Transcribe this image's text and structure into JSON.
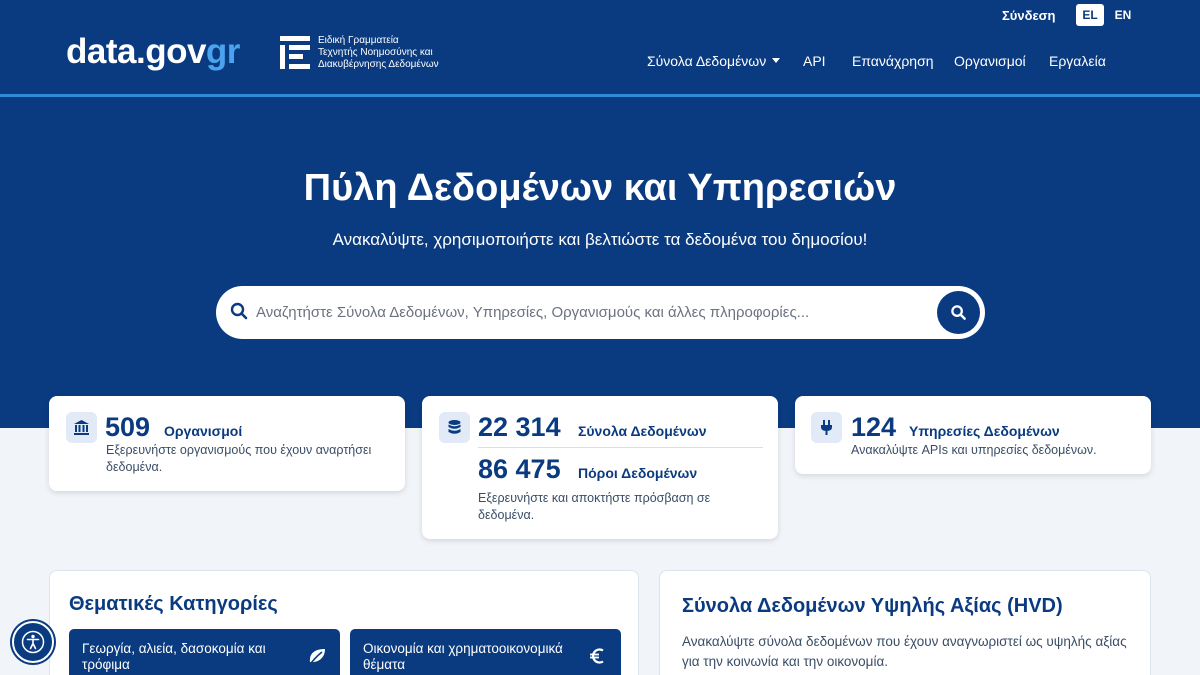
{
  "header": {
    "logo": {
      "main": "data.gov",
      "accent": "gr"
    },
    "agency_lines": [
      "Ειδική Γραμματεία",
      "Τεχνητής Νοημοσύνης και",
      "Διακυβέρνησης Δεδομένων"
    ],
    "login": "Σύνδεση",
    "languages": {
      "el": "EL",
      "en": "EN"
    },
    "nav": {
      "datasets": "Σύνολα Δεδομένων",
      "api": "API",
      "reuse": "Επανάχρηση",
      "organizations": "Οργανισμοί",
      "tools": "Εργαλεία"
    }
  },
  "hero": {
    "title": "Πύλη Δεδομένων και Υπηρεσιών",
    "subtitle": "Ανακαλύψτε, χρησιμοποιήστε και βελτιώστε τα δεδομένα του δημοσίου!",
    "search_placeholder": "Αναζητήστε Σύνολα Δεδομένων, Υπηρεσίες, Οργανισμούς και άλλες πληροφορίες..."
  },
  "stats": {
    "organizations": {
      "number": "509",
      "label": "Οργανισμοί",
      "desc": "Εξερευνήστε οργανισμούς που έχουν αναρτήσει δεδομένα."
    },
    "datasets": {
      "number": "22 314",
      "label": "Σύνολα Δεδομένων"
    },
    "resources": {
      "number": "86 475",
      "label": "Πόροι Δεδομένων",
      "desc": "Εξερευνήστε και αποκτήστε πρόσβαση σε δεδομένα."
    },
    "services": {
      "number": "124",
      "label": "Υπηρεσίες Δεδομένων",
      "desc": "Ανακαλύψτε APIs και υπηρεσίες δεδομένων."
    }
  },
  "categories": {
    "title": "Θεματικές Κατηγορίες",
    "items": [
      {
        "label": "Γεωργία, αλιεία, δασοκομία και τρόφιμα",
        "icon": "leaf-icon"
      },
      {
        "label": "Οικονομία και χρηματοοικονομικά θέματα",
        "icon": "euro-icon"
      }
    ]
  },
  "hvd": {
    "title": "Σύνολα Δεδομένων Υψηλής Αξίας (HVD)",
    "desc": "Ανακαλύψτε σύνολα δεδομένων που έχουν αναγνωριστεί ως υψηλής αξίας για την κοινωνία και την οικονομία."
  },
  "colors": {
    "brand": "#0a3b80",
    "accent": "#4aa3ee",
    "background": "#f1f4f9"
  }
}
